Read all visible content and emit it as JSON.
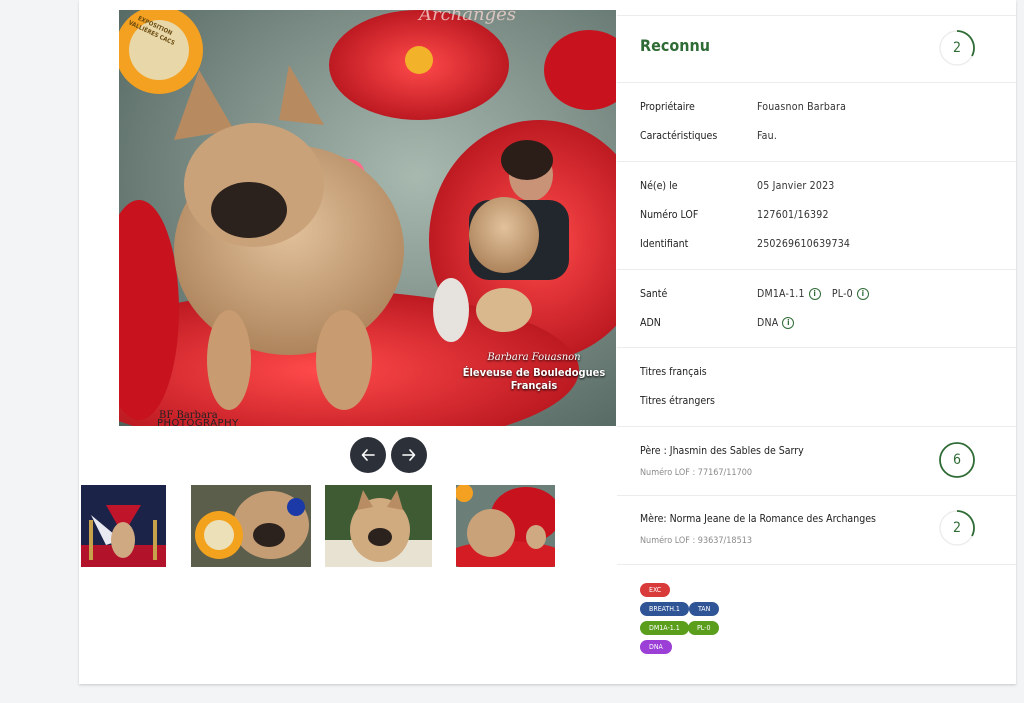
{
  "gallery": {
    "prev_label": "previous-photo",
    "next_label": "next-photo",
    "photo_top_text": "Archanges",
    "photo_signature": "Barbara Fouasnon",
    "photo_caption": "Éleveuse de Bouledogues Français",
    "photo_credit": "BF Barbara",
    "photo_credit2": "PHOTOGRAPHY",
    "rosette_text": "EXPOSITION VALLIÈRES CACS"
  },
  "status": {
    "title": "Reconnu",
    "count": "2"
  },
  "details": {
    "owner_label": "Propriétaire",
    "owner_value": "Fouasnon Barbara",
    "features_label": "Caractéristiques",
    "features_value": "Fau.",
    "born_label": "Né(e) le",
    "born_value": "05 Janvier 2023",
    "lof_label": "Numéro LOF",
    "lof_value": "127601/16392",
    "id_label": "Identifiant",
    "id_value": "250269610639734",
    "health_label": "Santé",
    "health_value_1": "DM1A-1.1",
    "health_value_2": "PL-0",
    "dna_label": "ADN",
    "dna_value": "DNA",
    "titles_fr_label": "Titres français",
    "titles_foreign_label": "Titres étrangers"
  },
  "father": {
    "name": "Père : Jhasmin des Sables de Sarry",
    "lof": "Numéro LOF : 77167/11700",
    "count": "6"
  },
  "mother": {
    "name": "Mère: Norma Jeane de la Romance des Archanges",
    "lof": "Numéro LOF : 93637/18513",
    "count": "2"
  },
  "badges": {
    "exc": "EXC",
    "breath": "BREATH.1",
    "tan": "TAN",
    "dm1a": "DM1A-1.1",
    "pl0": "PL-0",
    "dna": "DNA"
  },
  "colors": {
    "accent_green": "#2f6b35",
    "badge_red": "#d93a3a",
    "badge_blue": "#2f5597",
    "badge_green": "#5a9e1c",
    "badge_purple": "#9b3fd6",
    "nav_button": "#2c3039"
  }
}
